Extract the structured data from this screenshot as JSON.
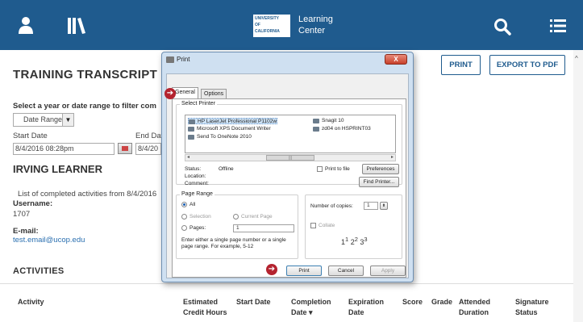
{
  "header": {
    "logo_lines": [
      "UNIVERSITY",
      "OF",
      "CALIFORNIA"
    ],
    "title_line1": "Learning",
    "title_line2": "Center",
    "icons": [
      "user-icon",
      "library-icon",
      "search-icon",
      "menu-icon"
    ]
  },
  "page": {
    "title": "TRAINING TRANSCRIPT",
    "filter_label": "Select a year or date range to filter com",
    "range_select": "Date Range",
    "start_date_label": "Start Date",
    "end_date_label": "End Dat",
    "start_date_value": "8/4/2016 08:28pm",
    "end_date_value": "8/4/20",
    "learner_name": "IRVING LEARNER",
    "completed_text": "List of completed activities from 8/4/2016",
    "username_label": "Username:",
    "username_value": "1707",
    "email_label": "E-mail:",
    "email_value": "test.email@ucop.edu",
    "activities_heading": "ACTIVITIES",
    "print_button": "PRINT",
    "export_button": "EXPORT TO PDF"
  },
  "table": {
    "columns": [
      {
        "line1": "Activity",
        "line2": ""
      },
      {
        "line1": "Estimated",
        "line2": "Credit Hours"
      },
      {
        "line1": "Start Date",
        "line2": ""
      },
      {
        "line1": "Completion",
        "line2": "Date ▾"
      },
      {
        "line1": "Expiration",
        "line2": "Date"
      },
      {
        "line1": "Score",
        "line2": ""
      },
      {
        "line1": "Grade",
        "line2": ""
      },
      {
        "line1": "Attended",
        "line2": "Duration"
      },
      {
        "line1": "Signature",
        "line2": "Status"
      }
    ]
  },
  "dialog": {
    "title": "Print",
    "close": "X",
    "tabs": [
      "General",
      "Options"
    ],
    "select_printer_label": "Select Printer",
    "printers": [
      "HP LaserJet Professional P1102w",
      "Microsoft XPS Document Writer",
      "Send To OneNote 2010",
      "Snagit 10",
      "zd04 on HSPRINT03"
    ],
    "selected_printer": "HP LaserJet Professional P1102w",
    "status_label": "Status:",
    "status_value": "Offline",
    "location_label": "Location:",
    "comment_label": "Comment:",
    "print_to_file": "Print to file",
    "preferences": "Preferences",
    "find_printer": "Find Printer...",
    "page_range_label": "Page Range",
    "range_all": "All",
    "range_selection": "Selection",
    "range_current": "Current Page",
    "range_pages": "Pages:",
    "pages_value": "1",
    "pages_hint": "Enter either a single page number or a single page range.  For example, 5-12",
    "copies_label": "Number of copies:",
    "copies_value": "1",
    "collate_label": "Collate",
    "collate_pages": [
      "1",
      "1",
      "2",
      "2",
      "3",
      "3"
    ],
    "print_button": "Print",
    "cancel_button": "Cancel",
    "apply_button": "Apply"
  },
  "colors": {
    "header_bg": "#1f5b8e",
    "accent": "#1f5b8e",
    "link": "#2a6fb0",
    "annotation_arrow": "#b4232f"
  }
}
